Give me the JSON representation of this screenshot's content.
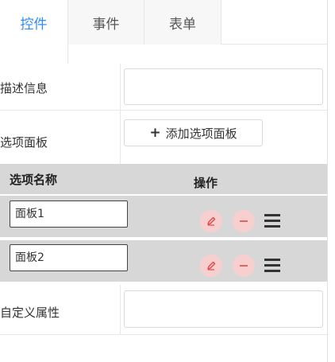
{
  "tabs": [
    {
      "label": "控件",
      "active": true
    },
    {
      "label": "事件",
      "active": false
    },
    {
      "label": "表单",
      "active": false
    }
  ],
  "form": {
    "description_label": "描述信息",
    "description_value": "",
    "options_panel_label": "选项面板",
    "add_option_button": "添加选项面板",
    "custom_attr_label": "自定义属性",
    "custom_attr_value": ""
  },
  "options_table": {
    "col_name": "选项名称",
    "col_actions": "操作",
    "rows": [
      {
        "value": "面板1"
      },
      {
        "value": "面板2"
      }
    ]
  },
  "colors": {
    "accent": "#2f8cf5",
    "action_circle": "#f8cfcf",
    "action_icon": "#e04848",
    "table_bg": "#d7d7d7"
  },
  "icons": {
    "add": "plus-icon",
    "edit": "edit-icon",
    "remove": "minus-icon",
    "drag": "drag-handle-icon"
  }
}
